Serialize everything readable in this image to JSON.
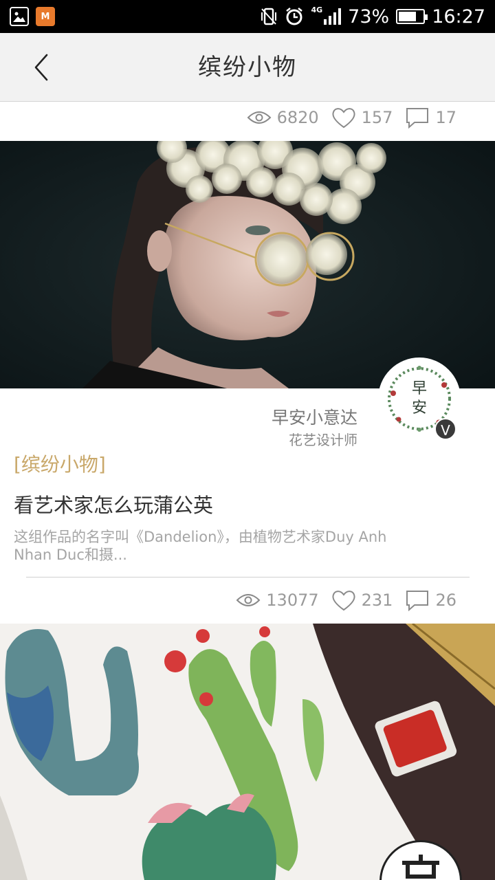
{
  "status_bar": {
    "battery": "73%",
    "battery_level": 0.73,
    "network": "4G",
    "time": "16:27",
    "app_icon_text": "M"
  },
  "header": {
    "title": "缤纷小物"
  },
  "post_above": {
    "views": "6820",
    "likes": "157",
    "comments": "17"
  },
  "post": {
    "author_name": "早安小意达",
    "author_role": "花艺设计师",
    "avatar_text_top": "早",
    "avatar_text_bottom": "安",
    "badge": "V",
    "tag": "[缤纷小物]",
    "title": "看艺术家怎么玩蒲公英",
    "summary": "这组作品的名字叫《Dandelion》，由植物艺术家Duy Anh Nhan Duc和摄...",
    "views": "13077",
    "likes": "231",
    "comments": "26"
  },
  "colors": {
    "tag": "#c9a86a",
    "header_bg": "#f2f2f2",
    "meta_gray": "#9a9a9a"
  }
}
